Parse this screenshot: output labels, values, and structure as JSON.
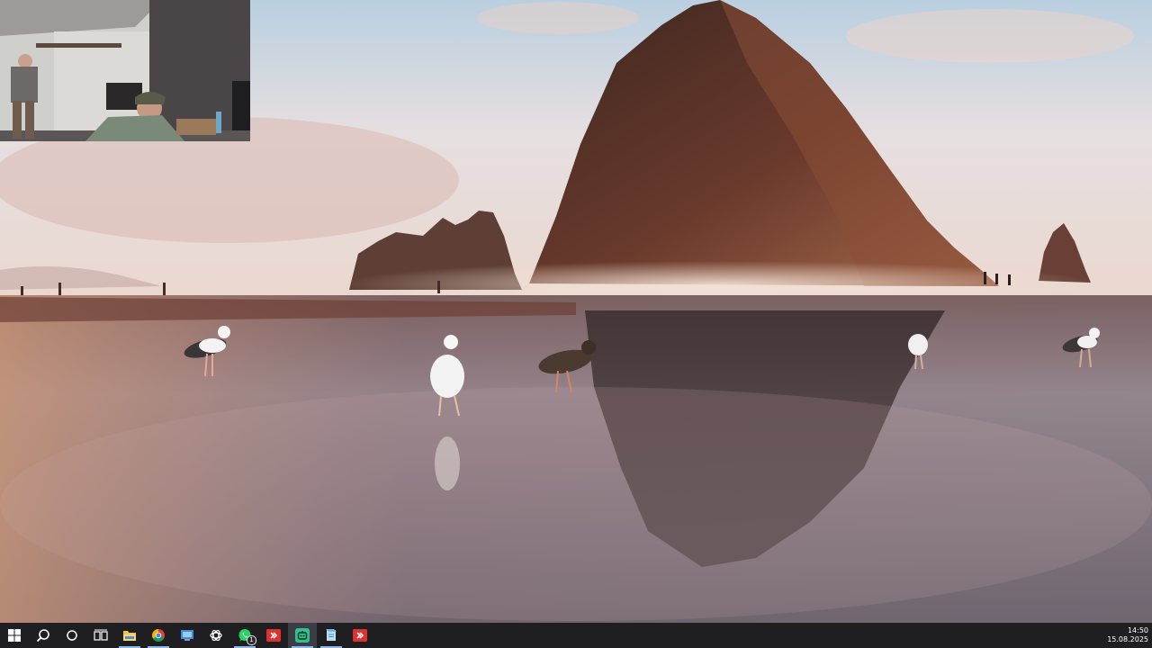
{
  "taskbar": {
    "items": [
      {
        "name": "start-button",
        "icon": "windows-logo-icon"
      },
      {
        "name": "search-button",
        "icon": "search-icon"
      },
      {
        "name": "cortana-button",
        "icon": "circle-icon"
      },
      {
        "name": "task-view-button",
        "icon": "task-view-icon"
      },
      {
        "name": "file-explorer-button",
        "icon": "folder-icon"
      },
      {
        "name": "chrome-button",
        "icon": "chrome-icon"
      },
      {
        "name": "remote-desktop-button",
        "icon": "remote-desktop-icon"
      },
      {
        "name": "chatgpt-button",
        "icon": "openai-icon"
      },
      {
        "name": "whatsapp-button",
        "icon": "whatsapp-icon",
        "badge": "1"
      },
      {
        "name": "red-app-button",
        "icon": "red-app-icon"
      },
      {
        "name": "green-app-button",
        "icon": "green-app-icon"
      },
      {
        "name": "notepad-button",
        "icon": "notepad-icon"
      },
      {
        "name": "red-app-2-button",
        "icon": "red-app-icon"
      }
    ],
    "accent": "#8fb8e8"
  },
  "clock": {
    "time": "14:50",
    "date": "15.08.2025"
  },
  "wallpaper": {
    "description_icon": "beach-seagulls-wallpaper"
  }
}
